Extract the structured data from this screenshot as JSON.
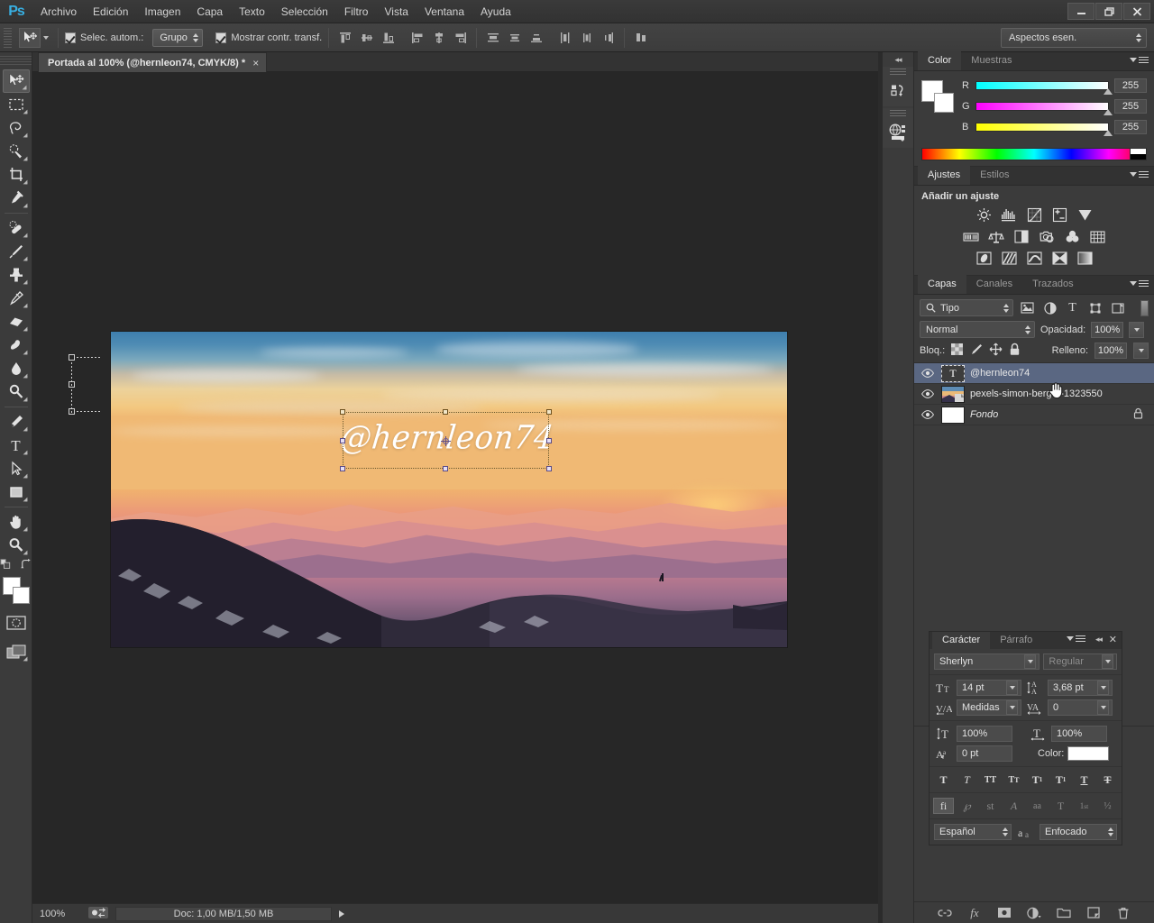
{
  "app": {
    "name": "Ps",
    "logo_color": "#38b0e3"
  },
  "menubar": {
    "items": [
      "Archivo",
      "Edición",
      "Imagen",
      "Capa",
      "Texto",
      "Selección",
      "Filtro",
      "Vista",
      "Ventana",
      "Ayuda"
    ]
  },
  "window_controls": {
    "minimize": "minimize-icon",
    "restore": "restore-icon",
    "close": "close-icon"
  },
  "options_bar": {
    "tool_icon": "move-tool-icon",
    "auto_select_label": "Selec. autom.:",
    "auto_select_checked": true,
    "group_value": "Grupo",
    "show_transform_label": "Mostrar contr. transf.",
    "show_transform_checked": true,
    "align_icons": [
      "align-top-edges-icon",
      "align-vertical-centers-icon",
      "align-bottom-edges-icon",
      "align-left-edges-icon",
      "align-horizontal-centers-icon",
      "align-right-edges-icon",
      "distribute-top-edges-icon",
      "distribute-vertical-centers-icon",
      "distribute-bottom-edges-icon",
      "distribute-left-edges-icon",
      "distribute-horizontal-centers-icon",
      "distribute-right-edges-icon",
      "auto-align-layers-icon"
    ],
    "workspace_value": "Aspectos esen."
  },
  "toolbar": {
    "tools": [
      {
        "name": "move-tool",
        "active": true
      },
      {
        "name": "rectangular-marquee-tool",
        "active": false
      },
      {
        "name": "lasso-tool",
        "active": false
      },
      {
        "name": "quick-selection-tool",
        "active": false
      },
      {
        "name": "crop-tool",
        "active": false
      },
      {
        "name": "eyedropper-tool",
        "active": false
      },
      {
        "name": "healing-brush-tool",
        "active": false
      },
      {
        "name": "brush-tool",
        "active": false
      },
      {
        "name": "clone-stamp-tool",
        "active": false
      },
      {
        "name": "history-brush-tool",
        "active": false
      },
      {
        "name": "eraser-tool",
        "active": false
      },
      {
        "name": "gradient-tool",
        "active": false
      },
      {
        "name": "blur-tool",
        "active": false
      },
      {
        "name": "dodge-tool",
        "active": false
      },
      {
        "name": "pen-tool",
        "active": false
      },
      {
        "name": "horizontal-type-tool",
        "active": false
      },
      {
        "name": "path-selection-tool",
        "active": false
      },
      {
        "name": "rectangle-tool",
        "active": false
      },
      {
        "name": "hand-tool",
        "active": false
      },
      {
        "name": "zoom-tool",
        "active": false
      }
    ],
    "foreground_color": "#ffffff",
    "background_color": "#ffffff",
    "quick_mask_icon": "quick-mask-icon",
    "screen_mode_icon": "screen-mode-icon"
  },
  "document": {
    "tab_title": "Portada al 100% (@hernleon74, CMYK/8) *",
    "close_label": "×"
  },
  "canvas": {
    "watermark_text": "@hernleon74",
    "watermark_color": "#ffffff"
  },
  "status_bar": {
    "zoom": "100%",
    "doc_info": "Doc: 1,00 MB/1,50 MB",
    "mode_icon": "screen-mode-icon"
  },
  "color_panel": {
    "tabs": [
      {
        "label": "Color",
        "active": true
      },
      {
        "label": "Muestras",
        "active": false
      }
    ],
    "channels": [
      {
        "label": "R",
        "value": "255"
      },
      {
        "label": "G",
        "value": "255"
      },
      {
        "label": "B",
        "value": "255"
      }
    ],
    "foreground": "#ffffff",
    "background": "#ffffff"
  },
  "adjustments_panel": {
    "tabs": [
      {
        "label": "Ajustes",
        "active": true
      },
      {
        "label": "Estilos",
        "active": false
      }
    ],
    "title": "Añadir un ajuste",
    "rows": [
      [
        "brightness-contrast-icon",
        "levels-icon",
        "curves-icon",
        "exposure-icon",
        "vibrance-icon"
      ],
      [
        "hue-saturation-icon",
        "color-balance-icon",
        "black-white-icon",
        "photo-filter-icon",
        "channel-mixer-icon",
        "color-lookup-icon"
      ],
      [
        "invert-icon",
        "posterize-icon",
        "threshold-icon",
        "selective-color-icon",
        "gradient-map-icon"
      ]
    ]
  },
  "layers_panel": {
    "tabs": [
      {
        "label": "Capas",
        "active": true
      },
      {
        "label": "Canales",
        "active": false
      },
      {
        "label": "Trazados",
        "active": false
      }
    ],
    "filter_value": "Tipo",
    "filter_icons": [
      "filter-pixel-icon",
      "filter-adjustment-icon",
      "filter-type-icon",
      "filter-shape-icon",
      "filter-smart-object-icon"
    ],
    "blend_mode": "Normal",
    "opacity_label": "Opacidad:",
    "opacity_value": "100%",
    "lock_label": "Bloq.:",
    "lock_icons": [
      "lock-transparent-pixels-icon",
      "lock-image-pixels-icon",
      "lock-position-icon",
      "lock-all-icon"
    ],
    "fill_label": "Relleno:",
    "fill_value": "100%",
    "layers": [
      {
        "name": "@hernleon74",
        "type": "text",
        "visible": true,
        "selected": true,
        "locked": false,
        "italic": false
      },
      {
        "name": "pexels-simon-berger-1323550",
        "type": "photo",
        "visible": true,
        "selected": false,
        "locked": false,
        "italic": false
      },
      {
        "name": "Fondo",
        "type": "solid",
        "visible": true,
        "selected": false,
        "locked": true,
        "italic": true
      }
    ],
    "footer_icons": [
      "link-layers-icon",
      "layer-style-icon",
      "layer-mask-icon",
      "new-fill-adjustment-icon",
      "new-group-icon",
      "new-layer-icon",
      "delete-layer-icon"
    ]
  },
  "character_panel": {
    "tabs": [
      {
        "label": "Carácter",
        "active": true
      },
      {
        "label": "Párrafo",
        "active": false
      }
    ],
    "font_family": "Sherlyn",
    "font_style": "Regular",
    "font_size_icon": "font-size-icon",
    "font_size": "14 pt",
    "leading_icon": "leading-icon",
    "leading": "3,68 pt",
    "kerning_icon": "kerning-icon",
    "kerning": "Medidas",
    "tracking_icon": "tracking-icon",
    "tracking": "0",
    "vertical_scale_icon": "vertical-scale-icon",
    "vertical_scale": "100%",
    "horizontal_scale_icon": "horizontal-scale-icon",
    "horizontal_scale": "100%",
    "baseline_shift_icon": "baseline-shift-icon",
    "baseline_shift": "0 pt",
    "color_label": "Color:",
    "color_value": "#ffffff",
    "style_buttons": [
      {
        "name": "faux-bold",
        "glyph": "T",
        "on": false
      },
      {
        "name": "faux-italic",
        "glyph": "T",
        "on": false
      },
      {
        "name": "all-caps",
        "glyph": "TT",
        "on": false
      },
      {
        "name": "small-caps",
        "glyph": "Tᴛ",
        "on": false
      },
      {
        "name": "superscript",
        "glyph": "T¹",
        "on": false
      },
      {
        "name": "subscript",
        "glyph": "T₁",
        "on": false
      },
      {
        "name": "underline",
        "glyph": "T",
        "on": false
      },
      {
        "name": "strikethrough",
        "glyph": "T",
        "on": false
      }
    ],
    "opentype_buttons": [
      {
        "name": "standard-ligatures",
        "glyph": "fi",
        "on": true
      },
      {
        "name": "contextual-alternates",
        "glyph": "℘",
        "on": false
      },
      {
        "name": "discretionary-ligatures",
        "glyph": "st",
        "on": false
      },
      {
        "name": "swash",
        "glyph": "𝒜",
        "on": false
      },
      {
        "name": "stylistic-alternates",
        "glyph": "aa",
        "on": false
      },
      {
        "name": "titling-alternates",
        "glyph": "T",
        "on": false
      },
      {
        "name": "ordinals",
        "glyph": "1st",
        "on": false
      },
      {
        "name": "fractions",
        "glyph": "½",
        "on": false
      }
    ],
    "language": "Español",
    "antialias_icon": "anti-alias-icon",
    "antialias": "Enfocado"
  },
  "right_rail": {
    "collapse_icon": "collapse-panels-icon",
    "items": [
      "history-panel-icon",
      "3d-panel-icon"
    ]
  }
}
